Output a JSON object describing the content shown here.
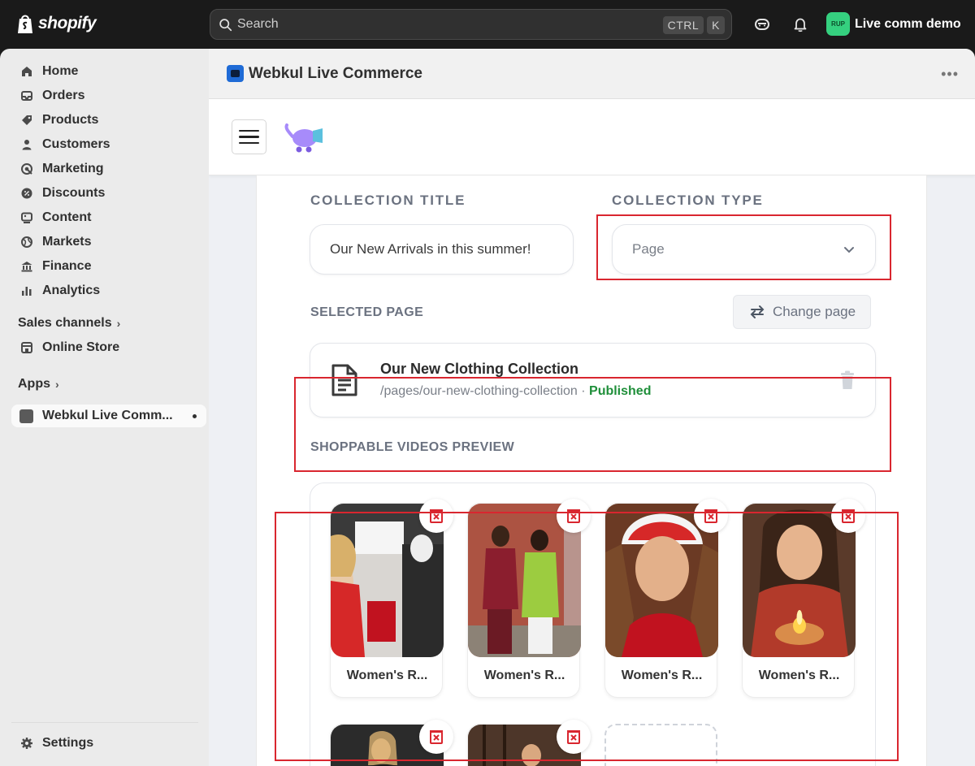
{
  "topbar": {
    "logo_text": "shopify",
    "search_placeholder": "Search",
    "shortcut_keys": [
      "CTRL",
      "K"
    ],
    "store_avatar": "RUP",
    "store_name": "Live comm demo",
    "icons": [
      "shopify-bag-icon",
      "search-icon",
      "sidekick-icon",
      "bell-icon"
    ]
  },
  "sidebar": {
    "items": [
      {
        "label": "Home",
        "icon": "home-icon"
      },
      {
        "label": "Orders",
        "icon": "orders-icon"
      },
      {
        "label": "Products",
        "icon": "tag-icon"
      },
      {
        "label": "Customers",
        "icon": "person-icon"
      },
      {
        "label": "Marketing",
        "icon": "target-icon"
      },
      {
        "label": "Discounts",
        "icon": "discount-icon"
      },
      {
        "label": "Content",
        "icon": "content-icon"
      },
      {
        "label": "Markets",
        "icon": "globe-icon"
      },
      {
        "label": "Finance",
        "icon": "bank-icon"
      },
      {
        "label": "Analytics",
        "icon": "bar-chart-icon"
      }
    ],
    "sales_channels_label": "Sales channels",
    "online_store_label": "Online Store",
    "apps_label": "Apps",
    "active_app_label": "Webkul Live Comm...",
    "settings_label": "Settings"
  },
  "app": {
    "title": "Webkul Live Commerce",
    "collection_title_label": "COLLECTION TITLE",
    "collection_title_value": "Our New Arrivals in this summer!",
    "collection_type_label": "COLLECTION TYPE",
    "collection_type_value": "Page",
    "selected_page_label": "SELECTED PAGE",
    "change_page_label": "Change page",
    "page": {
      "title": "Our New Clothing Collection",
      "path": "/pages/our-new-clothing-collection",
      "separator": " · ",
      "status": "Published"
    },
    "videos_label": "SHOPPABLE VIDEOS PREVIEW",
    "videos": [
      {
        "name": "Women's R..."
      },
      {
        "name": "Women's R..."
      },
      {
        "name": "Women's R..."
      },
      {
        "name": "Women's R..."
      }
    ]
  },
  "colors": {
    "highlight": "#d9262f",
    "published": "#1f8f3a",
    "store_avatar": "#35d07f"
  }
}
